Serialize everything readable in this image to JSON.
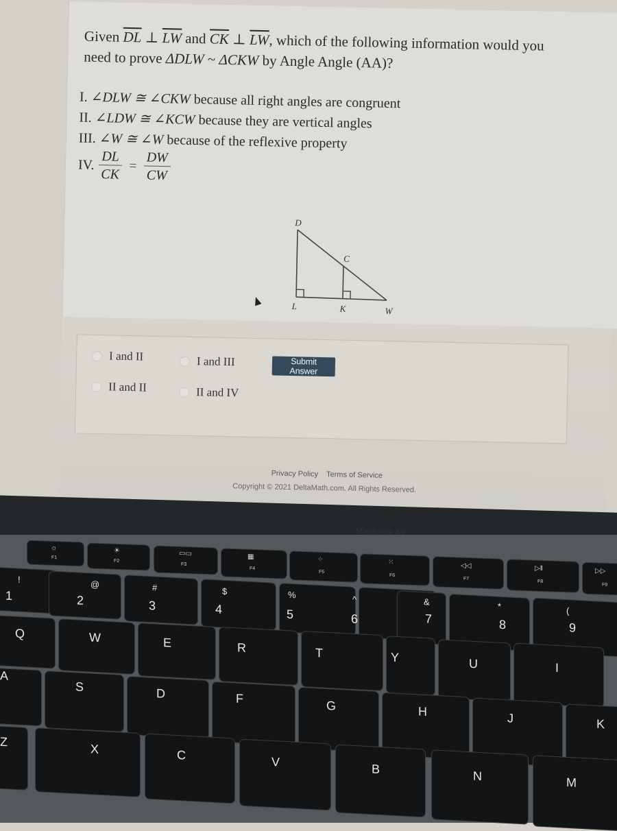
{
  "question": {
    "prefix": "Given",
    "seg1": "DL",
    "perp": "⊥",
    "seg2": "LW",
    "and": "and",
    "seg3": "CK",
    "seg4": "LW",
    "suffix_line1": ", which of the following information would you",
    "line2_prefix": "need to prove",
    "tri1": "ΔDLW",
    "sim": "~",
    "tri2": "ΔCKW",
    "line2_suffix": "by Angle Angle (AA)?"
  },
  "statements": [
    {
      "numeral": "I.",
      "expr": "∠DLW ≅ ∠CKW",
      "reason": "because all right angles are congruent"
    },
    {
      "numeral": "II.",
      "expr": "∠LDW ≅ ∠KCW",
      "reason": "because they are vertical angles"
    },
    {
      "numeral": "III.",
      "expr": "∠W ≅ ∠W",
      "reason": "because of the reflexive property"
    },
    {
      "numeral": "IV.",
      "frac1_num": "DL",
      "frac1_den": "CK",
      "equals": "=",
      "frac2_num": "DW",
      "frac2_den": "CW"
    }
  ],
  "diagram": {
    "points": {
      "D": "D",
      "C": "C",
      "L": "L",
      "K": "K",
      "W": "W"
    }
  },
  "options": [
    {
      "label": "I and II",
      "selected": false
    },
    {
      "label": "I and III",
      "selected": false
    },
    {
      "label": "II and II",
      "selected": false
    },
    {
      "label": "II and IV",
      "selected": false
    }
  ],
  "submit_label": "Submit Answer",
  "footer": {
    "privacy": "Privacy Policy",
    "terms": "Terms of Service",
    "copyright": "Copyright © 2021 DeltaMath.com. All Rights Reserved."
  },
  "laptop": {
    "brand": "MacBook Air"
  },
  "keyboard": {
    "fn_row": [
      {
        "icon": "☼",
        "label": "F1"
      },
      {
        "icon": "☀",
        "label": "F2"
      },
      {
        "icon": "▭▭",
        "label": "F3"
      },
      {
        "icon": "▦",
        "label": "F4"
      },
      {
        "icon": "⁘",
        "label": "F5"
      },
      {
        "icon": "⁙",
        "label": "F6"
      },
      {
        "icon": "◁◁",
        "label": "F7"
      },
      {
        "icon": "▷‖",
        "label": "F8"
      },
      {
        "icon": "▷▷",
        "label": "F9"
      }
    ],
    "number_row": [
      {
        "shift": "!",
        "main": "1"
      },
      {
        "shift": "@",
        "main": "2"
      },
      {
        "shift": "#",
        "main": "3"
      },
      {
        "shift": "$",
        "main": "4"
      },
      {
        "shift": "%",
        "main": "5"
      },
      {
        "shift": "^",
        "main": "6"
      },
      {
        "shift": "&",
        "main": "7"
      },
      {
        "shift": "*",
        "main": "8"
      },
      {
        "shift": "(",
        "main": "9"
      }
    ],
    "row_q": [
      "Q",
      "W",
      "E",
      "R",
      "T",
      "Y",
      "U",
      "I"
    ],
    "row_a": [
      "A",
      "S",
      "D",
      "F",
      "G",
      "H",
      "J",
      "K"
    ],
    "row_z": [
      "Z",
      "X",
      "C",
      "V",
      "B",
      "N",
      "M"
    ]
  }
}
